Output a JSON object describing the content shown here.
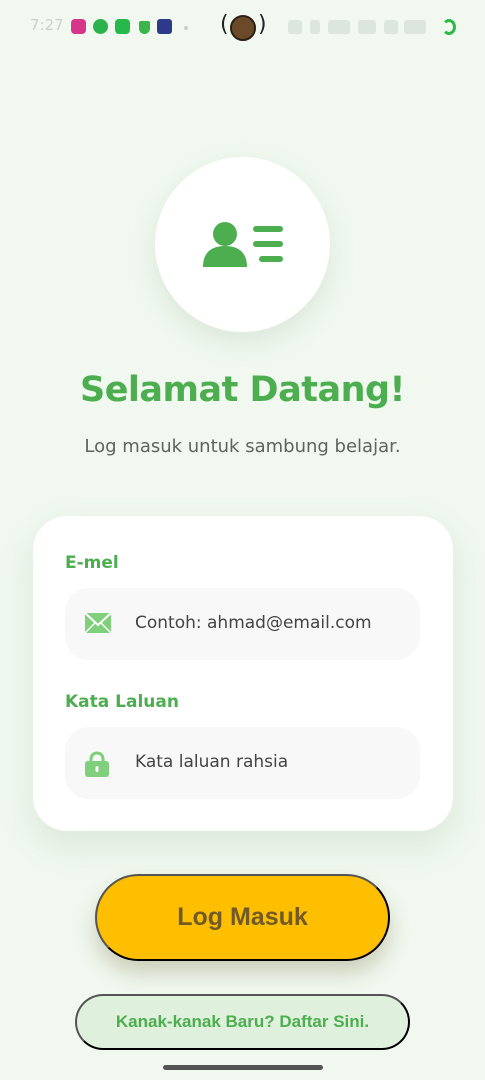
{
  "status_bar": {
    "time": "7:27"
  },
  "header": {
    "title": "Selamat Datang!",
    "subtitle": "Log masuk untuk sambung belajar."
  },
  "form": {
    "email_label": "E-mel",
    "email_placeholder": "Contoh: ahmad@email.com",
    "password_label": "Kata Laluan",
    "password_placeholder": "Kata laluan rahsia"
  },
  "actions": {
    "login_label": "Log Masuk",
    "register_label": "Kanak-kanak Baru? Daftar Sini."
  },
  "icons": {
    "profile": "user-list-icon",
    "email": "envelope-icon",
    "password": "lock-icon"
  },
  "colors": {
    "background": "#f0f8ef",
    "accent_green": "#4cae4f",
    "primary_button": "#fdbf00",
    "primary_button_text": "#715a25",
    "secondary_button": "#dff0dc"
  }
}
